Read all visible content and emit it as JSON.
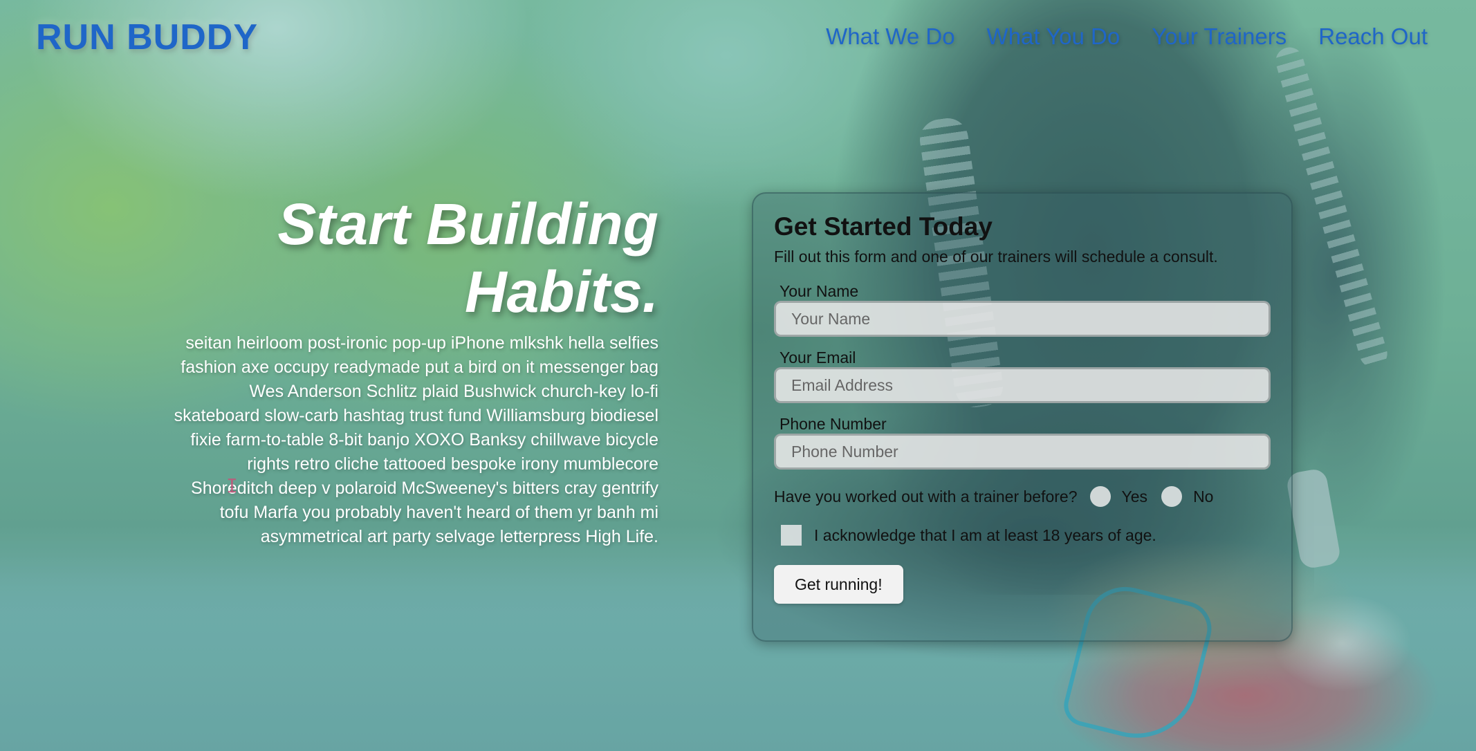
{
  "brand": {
    "logo_text": "RUN BUDDY"
  },
  "nav": {
    "items": [
      {
        "label": "What We Do"
      },
      {
        "label": "What You Do"
      },
      {
        "label": "Your Trainers"
      },
      {
        "label": "Reach Out"
      }
    ]
  },
  "hero": {
    "title": "Start Building Habits.",
    "body": "seitan heirloom post-ironic pop-up iPhone mlkshk hella selfies fashion axe occupy readymade put a bird on it messenger bag Wes Anderson Schlitz plaid Bushwick church-key lo-fi skateboard slow-carb hashtag trust fund Williamsburg biodiesel fixie farm-to-table 8-bit banjo XOXO Banksy chillwave bicycle rights retro cliche tattooed bespoke irony mumblecore Shoreditch deep v polaroid McSweeney's bitters cray gentrify tofu Marfa you probably haven't heard of them yr banh mi asymmetrical art party selvage letterpress High Life."
  },
  "form": {
    "title": "Get Started Today",
    "subtitle": "Fill out this form and one of our trainers will schedule a consult.",
    "name_label": "Your Name",
    "name_placeholder": "Your Name",
    "email_label": "Your Email",
    "email_placeholder": "Email Address",
    "phone_label": "Phone Number",
    "phone_placeholder": "Phone Number",
    "trainer_question": "Have you worked out with a trainer before?",
    "yes_label": "Yes",
    "no_label": "No",
    "age_ack": "I acknowledge that I am at least 18 years of age.",
    "submit_label": "Get running!"
  },
  "colors": {
    "brand": "#1f66c8",
    "hero_text": "#ffffff",
    "form_text": "#111111"
  }
}
